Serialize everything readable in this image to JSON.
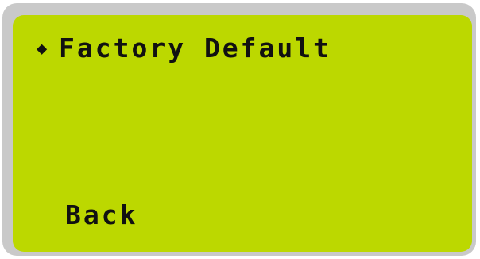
{
  "screen": {
    "colors": {
      "lcd_background": "#bcd800",
      "bezel": "#c9c9c9",
      "text": "#111111"
    },
    "menu": {
      "selector_icon": "diamond-icon",
      "selector_glyph": "◆",
      "items": [
        {
          "label": "Factory Default",
          "selected": true
        }
      ],
      "back_label": "Back"
    }
  }
}
